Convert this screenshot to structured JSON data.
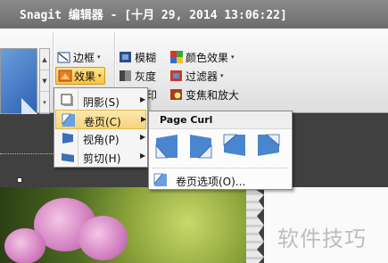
{
  "window": {
    "title": "Snagit 编辑器 - [十月 29, 2014 13:06:22]"
  },
  "ribbon": {
    "border_label": "边框",
    "effects_label": "效果",
    "blur_label": "模糊",
    "grayscale_label": "灰度",
    "spotlight_partial": "印",
    "color_effects_label": "颜色效果",
    "filters_label": "过滤器",
    "spotlight_magnify_label": "变焦和放大"
  },
  "effects_menu": {
    "items": [
      {
        "label": "阴影(S)",
        "icon": "shadow-icon"
      },
      {
        "label": "卷页(C)",
        "icon": "page-curl-icon"
      },
      {
        "label": "视角(P)",
        "icon": "perspective-icon"
      },
      {
        "label": "剪切(H)",
        "icon": "shear-icon"
      }
    ]
  },
  "page_curl_submenu": {
    "header": "Page Curl",
    "options_label": "卷页选项(O)..."
  },
  "watermark": {
    "text": "软件技巧"
  },
  "colors": {
    "highlight": "#f7c244",
    "menu_selected": "#f6d37b",
    "ribbon_bg": "#eaeaea",
    "titlebar": "#7a7a7a"
  }
}
